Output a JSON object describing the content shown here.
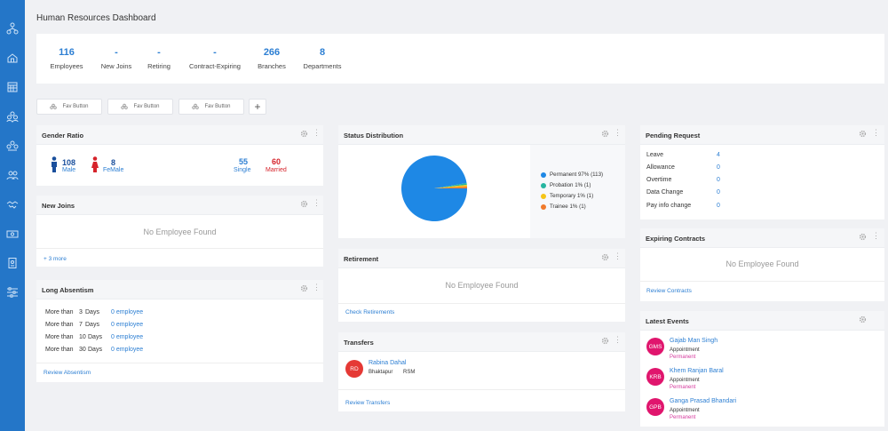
{
  "sidebar": {
    "icons": [
      "org-chart-icon",
      "home-icon",
      "calendar-grid-icon",
      "team-icon",
      "group-icon",
      "people-icon",
      "handshake-icon",
      "money-icon",
      "badge-icon",
      "settings-sliders-icon"
    ]
  },
  "page": {
    "title": "Human Resources Dashboard"
  },
  "stats": [
    {
      "value": "116",
      "label": "Employees"
    },
    {
      "value": "-",
      "label": "New Joins"
    },
    {
      "value": "-",
      "label": "Retiring"
    },
    {
      "value": "-",
      "label": "Contract-Expiring"
    },
    {
      "value": "266",
      "label": "Branches"
    },
    {
      "value": "8",
      "label": "Departments"
    }
  ],
  "favorites": {
    "buttons": [
      "Fav Button",
      "Fav Button",
      "Fav Button"
    ],
    "add": "+"
  },
  "gender_ratio": {
    "title": "Gender Ratio",
    "male_count": "108",
    "male_label": "Male",
    "female_count": "8",
    "female_label": "FeMale",
    "single_count": "55",
    "single_label": "Single",
    "married_count": "60",
    "married_label": "Married"
  },
  "new_joins": {
    "title": "New Joins",
    "empty": "No Employee Found",
    "more": "+ 3 more"
  },
  "long_absentism": {
    "title": "Long Absentism",
    "rows": [
      {
        "prefix": "More than",
        "days": "3",
        "unit": "Days",
        "count": "0 employee"
      },
      {
        "prefix": "More than",
        "days": "7",
        "unit": "Days",
        "count": "0 employee"
      },
      {
        "prefix": "More than",
        "days": "10",
        "unit": "Days",
        "count": "0 employee"
      },
      {
        "prefix": "More than",
        "days": "30",
        "unit": "Days",
        "count": "0 employee"
      }
    ],
    "link": "Review Absentism"
  },
  "status_distribution": {
    "title": "Status Distribution",
    "legend": [
      {
        "label": "Permanent 97% (113)",
        "color": "#1e88e5"
      },
      {
        "label": "Probation 1% (1)",
        "color": "#26b5a0"
      },
      {
        "label": "Temporary 1% (1)",
        "color": "#f5c518"
      },
      {
        "label": "Trainee 1% (1)",
        "color": "#f07a2b"
      }
    ]
  },
  "chart_data": {
    "type": "pie",
    "categories": [
      "Permanent",
      "Probation",
      "Temporary",
      "Trainee"
    ],
    "values": [
      113,
      1,
      1,
      1
    ],
    "percentages": [
      97,
      1,
      1,
      1
    ],
    "colors": [
      "#1e88e5",
      "#26b5a0",
      "#f5c518",
      "#f07a2b"
    ],
    "title": "Status Distribution",
    "legend": "right"
  },
  "retirement": {
    "title": "Retirement",
    "empty": "No Employee Found",
    "link": "Check Retirements"
  },
  "transfers": {
    "title": "Transfers",
    "item": {
      "initials": "RD",
      "name": "Rabina Dahal",
      "location": "Bhaktapur",
      "code": "RSM"
    },
    "link": "Review Transfers"
  },
  "pending_request": {
    "title": "Pending Request",
    "rows": [
      {
        "label": "Leave",
        "value": "4"
      },
      {
        "label": "Allowance",
        "value": "0"
      },
      {
        "label": "Overtime",
        "value": "0"
      },
      {
        "label": "Data Change",
        "value": "0"
      },
      {
        "label": "Pay info change",
        "value": "0"
      }
    ]
  },
  "expiring_contracts": {
    "title": "Expiring Contracts",
    "empty": "No Employee Found",
    "link": "Review Contracts"
  },
  "latest_events": {
    "title": "Latest Events",
    "items": [
      {
        "initials": "GMS",
        "name": "Gajab Man Singh",
        "type": "Appointment",
        "status": "Permanent"
      },
      {
        "initials": "KRB",
        "name": "Khem Ranjan Baral",
        "type": "Appointment",
        "status": "Permanent"
      },
      {
        "initials": "GPB",
        "name": "Ganga Prasad Bhandari",
        "type": "Appointment",
        "status": "Permanent"
      }
    ]
  },
  "colors": {
    "sidebar": "#2476c8",
    "accent": "#2d7fd3",
    "male": "#1a4f9c",
    "female": "#d6232b",
    "avatar": "#e0156d",
    "transfer_avatar": "#e53935"
  }
}
